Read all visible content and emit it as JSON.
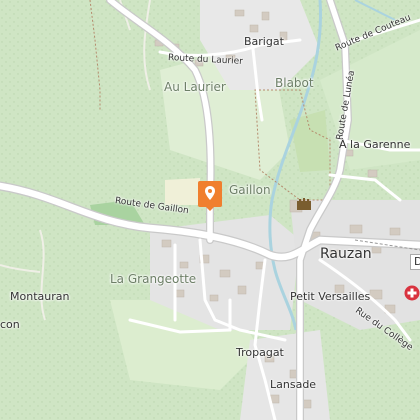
{
  "map": {
    "colors": {
      "forest": "#cfe5c4",
      "field": "#dfeed4",
      "urban": "#e4e4e4",
      "road": "#ffffff",
      "water": "#aad3df",
      "marker": "#f07f2e",
      "poi_red": "#d9333f"
    },
    "labels": {
      "barigat": "Barigat",
      "route_du_laurier": "Route du Laurier",
      "au_laurier": "Au Laurier",
      "blabot": "Blabot",
      "route_de_couteau": "Route de Couteau",
      "route_de_lune": "Route de Lunéa",
      "a_la_garenne": "À la Garenne",
      "gaillon": "Gaillon",
      "route_de_gaillon": "Route de Gaillon",
      "rauzan": "Rauzan",
      "la_grangeotte": "La Grangeotte",
      "montauran": "Montauran",
      "con": "con",
      "petit_versailles": "Petit Versailles",
      "rue_du_college": "Rue du Collège",
      "tropagat": "Tropagat",
      "lansade": "Lansade",
      "cut_d": "D"
    },
    "icons": {
      "location_marker": "map-marker-icon",
      "castle": "castle-icon",
      "red_poi": "poi-icon"
    }
  }
}
